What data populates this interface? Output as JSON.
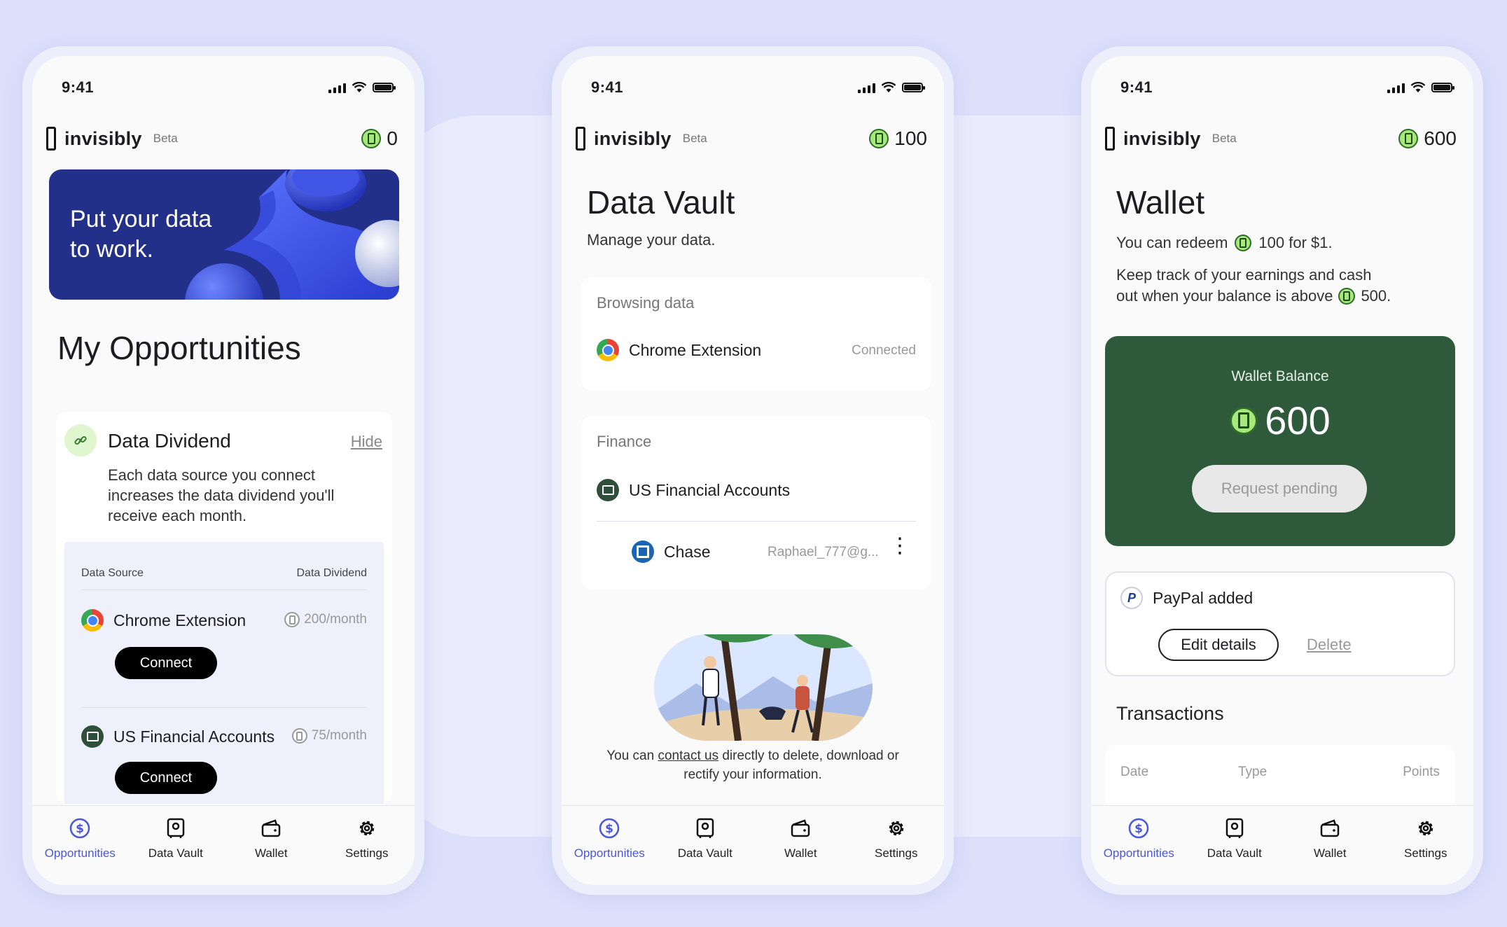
{
  "status": {
    "time": "9:41"
  },
  "brand": {
    "name": "invisibly",
    "beta": "Beta"
  },
  "nav": [
    "Opportunities",
    "Data Vault",
    "Wallet",
    "Settings"
  ],
  "phone1": {
    "points": "0",
    "hero": "Put your data to work.",
    "title": "My Opportunities",
    "dividend": {
      "title": "Data Dividend",
      "hide": "Hide",
      "desc": "Each data source you connect increases the data dividend you'll receive each month.",
      "col_source": "Data Source",
      "col_dividend": "Data Dividend",
      "rows": [
        {
          "label": "Chrome Extension",
          "rate": "200/month",
          "button": "Connect"
        },
        {
          "label": "US Financial Accounts",
          "rate": "75/month",
          "button": "Connect"
        }
      ]
    }
  },
  "phone2": {
    "points": "100",
    "title": "Data Vault",
    "subtitle": "Manage your data.",
    "browsing": {
      "title": "Browsing data",
      "item": "Chrome Extension",
      "status": "Connected"
    },
    "finance": {
      "title": "Finance",
      "item": "US Financial Accounts",
      "bank": "Chase",
      "account": "Raphael_777@g..."
    },
    "contact_pre": "You can ",
    "contact_link": "contact us",
    "contact_post": " directly to delete, download or rectify your information."
  },
  "phone3": {
    "points": "600",
    "title": "Wallet",
    "redeem_pre": "You can redeem",
    "redeem_post": "100 for $1.",
    "track": "Keep track of your earnings and cash",
    "track2_pre": "out when your balance is above",
    "track2_post": "500.",
    "balance_label": "Wallet Balance",
    "balance": "600",
    "pending": "Request pending",
    "paypal": "PayPal added",
    "paypal_mark": "P",
    "edit": "Edit details",
    "delete": "Delete",
    "transactions": "Transactions",
    "tx_cols": [
      "Date",
      "Type",
      "Points"
    ]
  },
  "colors": {
    "accent": "#4a57d8",
    "wallet_green": "#2e5a3b",
    "hero_blue": "#22308a",
    "coin_green": "#a6e87a"
  }
}
